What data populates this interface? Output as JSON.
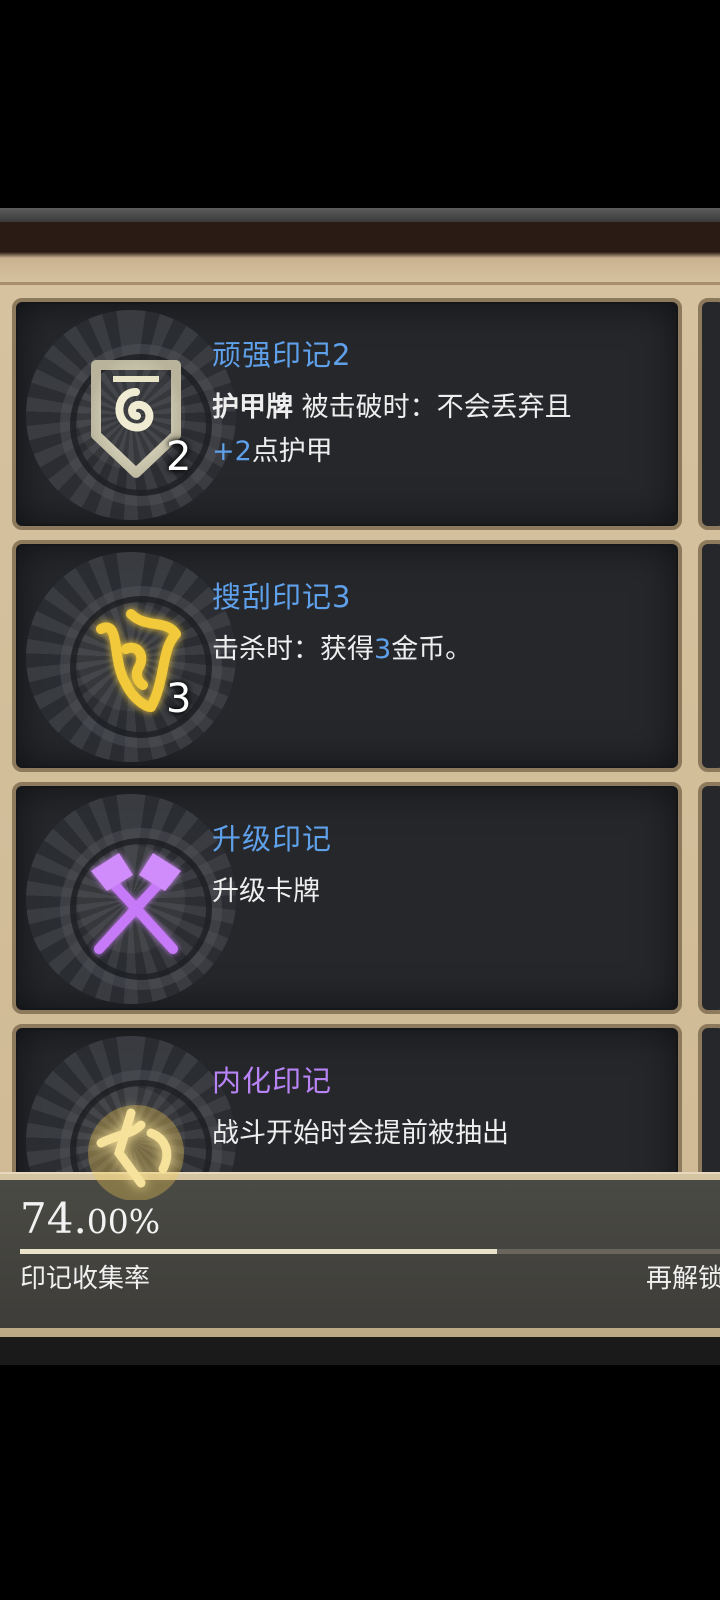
{
  "marks": [
    {
      "title": "顽强印记2",
      "title_color": "#5fa0ea",
      "level": "2",
      "icon": "shield-spiral-icon",
      "desc_parts": [
        {
          "text": "护甲牌",
          "style": "bold"
        },
        {
          "text": " 被击破时：不会丢弃且",
          "style": "normal"
        },
        {
          "text": "+2",
          "style": "hl"
        },
        {
          "text": "点护甲",
          "style": "normal"
        }
      ]
    },
    {
      "title": "搜刮印记3",
      "title_color": "#5fa0ea",
      "level": "3",
      "icon": "gold-rune-icon",
      "desc_parts": [
        {
          "text": "击杀时：获得",
          "style": "normal"
        },
        {
          "text": "3",
          "style": "hl"
        },
        {
          "text": "金币。",
          "style": "normal"
        }
      ]
    },
    {
      "title": "升级印记",
      "title_color": "#5fa0ea",
      "level": "",
      "icon": "crossed-hammers-icon",
      "desc_parts": [
        {
          "text": "升级卡牌",
          "style": "normal"
        }
      ]
    },
    {
      "title": "内化印记",
      "title_color": "#b884f5",
      "level": "",
      "icon": "gold-rune-2-icon",
      "desc_parts": [
        {
          "text": "战斗开始时会提前被抽出",
          "style": "normal"
        }
      ]
    }
  ],
  "collection": {
    "percent_main": "74.",
    "percent_decimal": "00%",
    "progress": 0.74,
    "label": "印记收集率",
    "regen_label": "再解锁"
  }
}
